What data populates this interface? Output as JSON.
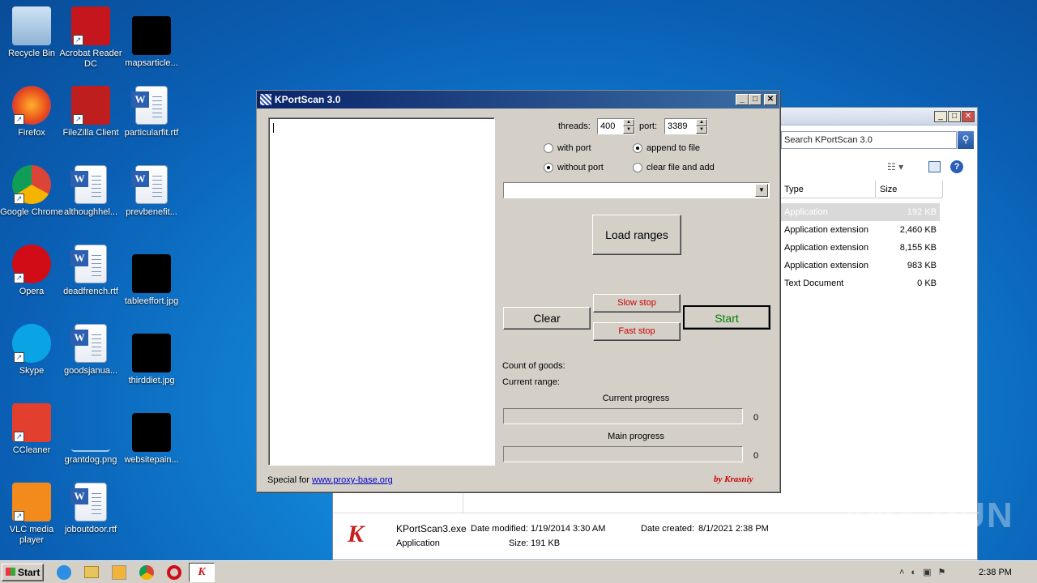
{
  "desktop": {
    "icons": [
      {
        "label": "Recycle Bin",
        "icon": "recycle-bin-icon"
      },
      {
        "label": "Acrobat Reader DC",
        "icon": "acrobat-icon"
      },
      {
        "label": "mapsarticle...",
        "icon": "image-file-icon"
      },
      {
        "label": "Firefox",
        "icon": "firefox-icon"
      },
      {
        "label": "FileZilla Client",
        "icon": "filezilla-icon"
      },
      {
        "label": "particularfit.rtf",
        "icon": "word-doc-icon"
      },
      {
        "label": "Google Chrome",
        "icon": "chrome-icon"
      },
      {
        "label": "althoughhel...",
        "icon": "word-doc-icon"
      },
      {
        "label": "prevbenefit...",
        "icon": "word-doc-icon"
      },
      {
        "label": "Opera",
        "icon": "opera-icon"
      },
      {
        "label": "deadfrench.rtf",
        "icon": "word-doc-icon"
      },
      {
        "label": "tableeffort.jpg",
        "icon": "image-file-icon"
      },
      {
        "label": "Skype",
        "icon": "skype-icon"
      },
      {
        "label": "goodsjanua...",
        "icon": "word-doc-icon"
      },
      {
        "label": "thirddiet.jpg",
        "icon": "image-file-icon"
      },
      {
        "label": "CCleaner",
        "icon": "ccleaner-icon"
      },
      {
        "label": "grantdog.png",
        "icon": "image-file-icon"
      },
      {
        "label": "websitepain...",
        "icon": "image-file-icon"
      },
      {
        "label": "VLC media player",
        "icon": "vlc-icon"
      },
      {
        "label": "joboutdoor.rtf",
        "icon": "word-doc-icon"
      }
    ]
  },
  "explorer": {
    "search_placeholder": "Search KPortScan 3.0",
    "columns": {
      "type": "Type",
      "size": "Size"
    },
    "rows": [
      {
        "type": "Application",
        "size": "192 KB"
      },
      {
        "type": "Application extension",
        "size": "2,460 KB"
      },
      {
        "type": "Application extension",
        "size": "8,155 KB"
      },
      {
        "type": "Application extension",
        "size": "983 KB"
      },
      {
        "type": "Text Document",
        "size": "0 KB"
      }
    ],
    "details": {
      "name": "KPortScan3.exe",
      "modified_label": "Date modified:",
      "modified": "1/19/2014 3:30 AM",
      "created_label": "Date created:",
      "created": "8/1/2021 2:38 PM",
      "kind": "Application",
      "size_label": "Size:",
      "size": "191 KB"
    }
  },
  "dialog": {
    "title": "KPortScan 3.0",
    "threads_label": "threads:",
    "threads_value": "400",
    "port_label": "port:",
    "port_value": "3389",
    "radio_with_port": "with port",
    "radio_without_port": "without port",
    "radio_append": "append to file",
    "radio_clear_add": "clear file and add",
    "load_ranges": "Load ranges",
    "clear": "Clear",
    "slow_stop": "Slow stop",
    "fast_stop": "Fast stop",
    "start": "Start",
    "count_label": "Count of goods:",
    "range_label": "Current range:",
    "current_progress_label": "Current progress",
    "current_progress_value": "0",
    "main_progress_label": "Main progress",
    "main_progress_value": "0",
    "current_progress": 0,
    "main_progress": 0,
    "special_for": "Special for",
    "link": "www.proxy-base.org",
    "by": "by Krasniy"
  },
  "taskbar": {
    "start": "Start",
    "clock": "2:38 PM"
  },
  "watermark": "ANY RUN",
  "colors": {
    "stop_red": "#cc0000",
    "start_green": "#008000",
    "title_blue": "#0a246a"
  }
}
